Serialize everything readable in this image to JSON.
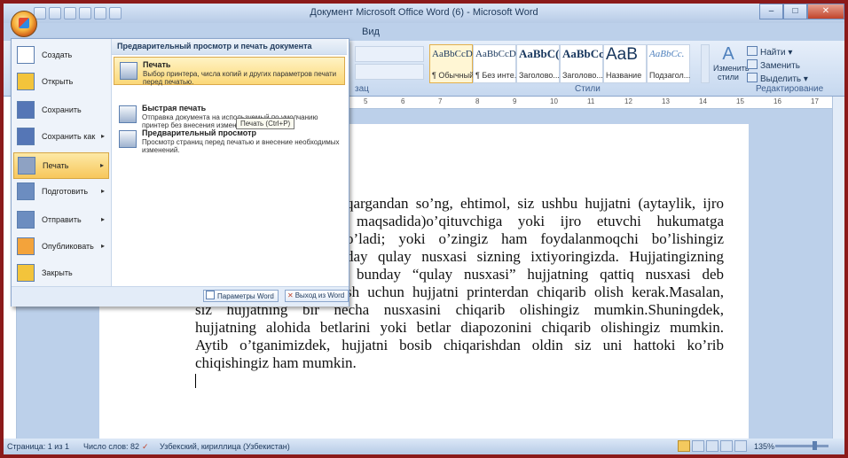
{
  "window": {
    "title": "Документ Microsoft Office Word (6) - Microsoft Word"
  },
  "ribbon": {
    "visible_tab": "Вид",
    "styles_group": "Стили",
    "paragraph_group_fragment": "зац",
    "styles": [
      {
        "sample": "AaBbCcDc",
        "name": "¶ Обычный"
      },
      {
        "sample": "AaBbCcDc",
        "name": "¶ Без инте..."
      },
      {
        "sample": "AaBbC(",
        "name": "Заголово..."
      },
      {
        "sample": "AaBbCc",
        "name": "Заголово..."
      },
      {
        "sample": "AaB",
        "name": "Название"
      },
      {
        "sample": "AaBbCc.",
        "name": "Подзагол..."
      }
    ],
    "change_styles": "Изменить стили",
    "editing_group": "Редактирование",
    "find": "Найти",
    "replace": "Заменить",
    "select": "Выделить"
  },
  "office_menu": {
    "left_items": [
      {
        "label": "Создать",
        "icon": "new-document-icon"
      },
      {
        "label": "Открыть",
        "icon": "open-folder-icon"
      },
      {
        "label": "Сохранить",
        "icon": "save-icon"
      },
      {
        "label": "Сохранить как",
        "icon": "save-as-icon",
        "arrow": "▸"
      },
      {
        "label": "Печать",
        "icon": "print-icon",
        "arrow": "▸"
      },
      {
        "label": "Подготовить",
        "icon": "prepare-icon",
        "arrow": "▸"
      },
      {
        "label": "Отправить",
        "icon": "send-icon",
        "arrow": "▸"
      },
      {
        "label": "Опубликовать",
        "icon": "publish-icon",
        "arrow": "▸"
      },
      {
        "label": "Закрыть",
        "icon": "close-folder-icon"
      }
    ],
    "right_header": "Предварительный просмотр и печать документа",
    "right_items": [
      {
        "title": "Печать",
        "desc": "Выбор принтера, числа копий и других параметров печати перед печатью."
      },
      {
        "title": "Быстрая печать",
        "desc": "Отправка документа на используемый по умолчанию принтер без внесения изменений."
      },
      {
        "title": "Предварительный просмотр",
        "desc": "Просмотр страниц перед печатью и внесение необходимых изменений."
      }
    ],
    "tooltip": "Печать (Ctrl+P)",
    "word_options": "Параметры Word",
    "exit_word": "Выход из Word"
  },
  "document": {
    "lines": [
      "qargandan so’ng, ehtimol, siz ushbu hujjatni (aytaylik, ijro",
      "maqsadida)o’qituvchiga yoki ijro etuvchi hukumatga",
      "o’ladi; yoki o’zingiz ham foydalanmoqchi bo’lishingiz",
      "day qulay nusxasi sizning ixtiyoringizda. Hujjatingizning",
      "bunday “qulay nusxasi” hujjatning qattiq nusxasi deb",
      "sh uchun hujjatni printerdan chiqarib olish kerak.Masalan,",
      "siz hujjatning bir necha nusxasini chiqarib olishingiz mumkin.Shuningdek,",
      "hujjatning alohida betlarini yoki betlar diapozonini chiqarib olishingiz mumkin.",
      "Aytib o’tganimizdek, hujjatni bosib chiqarishdan oldin siz uni hattoki ko’rib",
      "chiqishingiz ham mumkin."
    ]
  },
  "ruler": {
    "marks": [
      "5",
      "6",
      "7",
      "8",
      "9",
      "10",
      "11",
      "12",
      "13",
      "14",
      "15",
      "16",
      "17"
    ]
  },
  "statusbar": {
    "page": "Страница: 1 из 1",
    "words": "Число слов: 82",
    "language": "Узбекский, кириллица (Узбекистан)",
    "zoom": "135%"
  },
  "colors": {
    "accent": "#1e395b",
    "menu_highlight": "#f7c75b",
    "frame_border": "#8b1a1a"
  }
}
